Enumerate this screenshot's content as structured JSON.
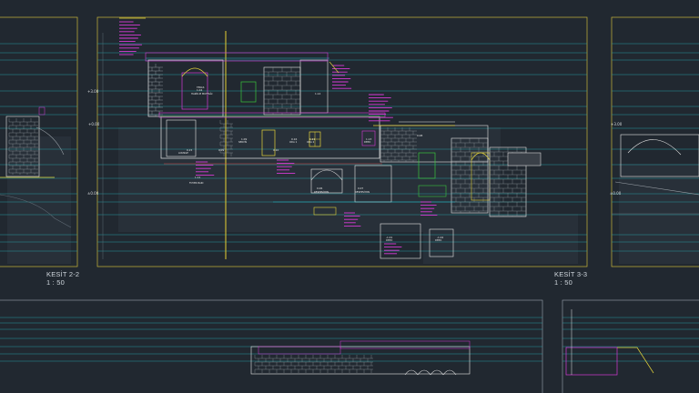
{
  "viewport": {
    "background": "#212830",
    "frame_color": "#c9b73a",
    "level_line_color": "#27a7ad",
    "line_colors": {
      "white": "#e6e6e6",
      "magenta": "#d63ad6",
      "yellow": "#e3d33a",
      "cyan": "#27b9c9",
      "green": "#39c53c",
      "red": "#d84040",
      "blue": "#3a52b0"
    }
  },
  "sections": [
    {
      "title": "KESİT 2-2",
      "scale": "1 : 50"
    },
    {
      "title": "KESİT 3-3",
      "scale": "1 : 50"
    }
  ],
  "elevation_labels": [
    "+3.00",
    "+0.00",
    "±0.00",
    "+3.00",
    "±0.00"
  ],
  "room_labels": [
    "TERAS",
    "HAZİR.M MUTFAĞI",
    "LOUNGE",
    "SERVİS",
    "ODA 1",
    "ODA 2",
    "DEPO",
    "FOYER BARI",
    "RESEPSİYON",
    "RESEPSİYON",
    "DEPO",
    "DEPO"
  ],
  "room_numbers": [
    "1.04",
    "0.15",
    "1.09",
    "0.16",
    "1.11",
    "1.13",
    "1.14",
    "1.12",
    "0.06",
    "0.07",
    "0.08",
    "0.09",
    "0.10",
    "-1.01",
    "-1.02"
  ]
}
